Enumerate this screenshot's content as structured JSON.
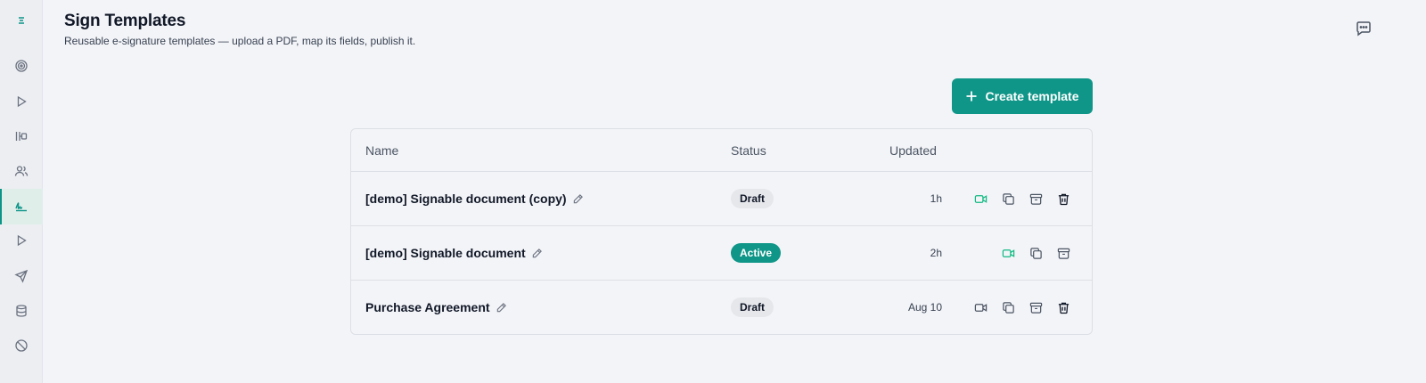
{
  "header": {
    "title": "Sign Templates",
    "subtitle": "Reusable e-signature templates — upload a PDF, map its fields, publish it."
  },
  "actions": {
    "create_label": "Create template"
  },
  "table": {
    "columns": [
      "Name",
      "Status",
      "Updated"
    ],
    "rows": [
      {
        "name": "[demo] Signable document (copy)",
        "status": "Draft",
        "updated": "1h",
        "video_active": true,
        "deletable": true
      },
      {
        "name": "[demo] Signable document",
        "status": "Active",
        "updated": "2h",
        "video_active": true,
        "deletable": false
      },
      {
        "name": "Purchase Agreement",
        "status": "Draft",
        "updated": "Aug 10",
        "video_active": false,
        "deletable": true
      }
    ]
  },
  "sidebar": {
    "items": [
      "logo-icon",
      "target-icon",
      "play-icon",
      "columns-icon",
      "users-icon",
      "signature-icon",
      "play-icon",
      "send-icon",
      "database-icon",
      "ban-icon"
    ],
    "active_index": 5
  },
  "colors": {
    "accent": "#0f9688",
    "active_video": "#10b981"
  }
}
